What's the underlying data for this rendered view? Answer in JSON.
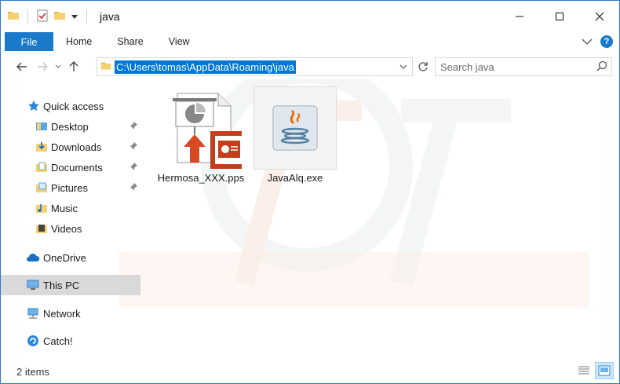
{
  "window": {
    "title": "java",
    "colors": {
      "accent": "#1979ca",
      "selection": "#0078d7",
      "frame": "#2b79d0"
    }
  },
  "ribbon": {
    "file_tab": "File",
    "tabs": [
      "Home",
      "Share",
      "View"
    ]
  },
  "address_bar": {
    "path": "C:\\Users\\tomas\\AppData\\Roaming\\java",
    "search_placeholder": "Search java"
  },
  "sidebar": {
    "items": [
      {
        "label": "Quick access",
        "icon": "star-icon",
        "pinned": false
      },
      {
        "label": "Desktop",
        "icon": "folder-desktop-icon",
        "pinned": true
      },
      {
        "label": "Downloads",
        "icon": "folder-downloads-icon",
        "pinned": true
      },
      {
        "label": "Documents",
        "icon": "folder-documents-icon",
        "pinned": true
      },
      {
        "label": "Pictures",
        "icon": "folder-pictures-icon",
        "pinned": true
      },
      {
        "label": "Music",
        "icon": "folder-music-icon",
        "pinned": false
      },
      {
        "label": "Videos",
        "icon": "folder-videos-icon",
        "pinned": false
      },
      {
        "label": "OneDrive",
        "icon": "cloud-icon",
        "pinned": false
      },
      {
        "label": "This PC",
        "icon": "computer-icon",
        "pinned": false,
        "selected": true
      },
      {
        "label": "Network",
        "icon": "network-icon",
        "pinned": false
      },
      {
        "label": "Catch!",
        "icon": "catch-icon",
        "pinned": false
      }
    ]
  },
  "files": [
    {
      "name": "Hermosa_XXX.pps",
      "icon": "powerpoint-slideshow-icon"
    },
    {
      "name": "JavaAlq.exe",
      "icon": "java-icon",
      "selected": true
    }
  ],
  "status": {
    "item_count": "2 items"
  }
}
